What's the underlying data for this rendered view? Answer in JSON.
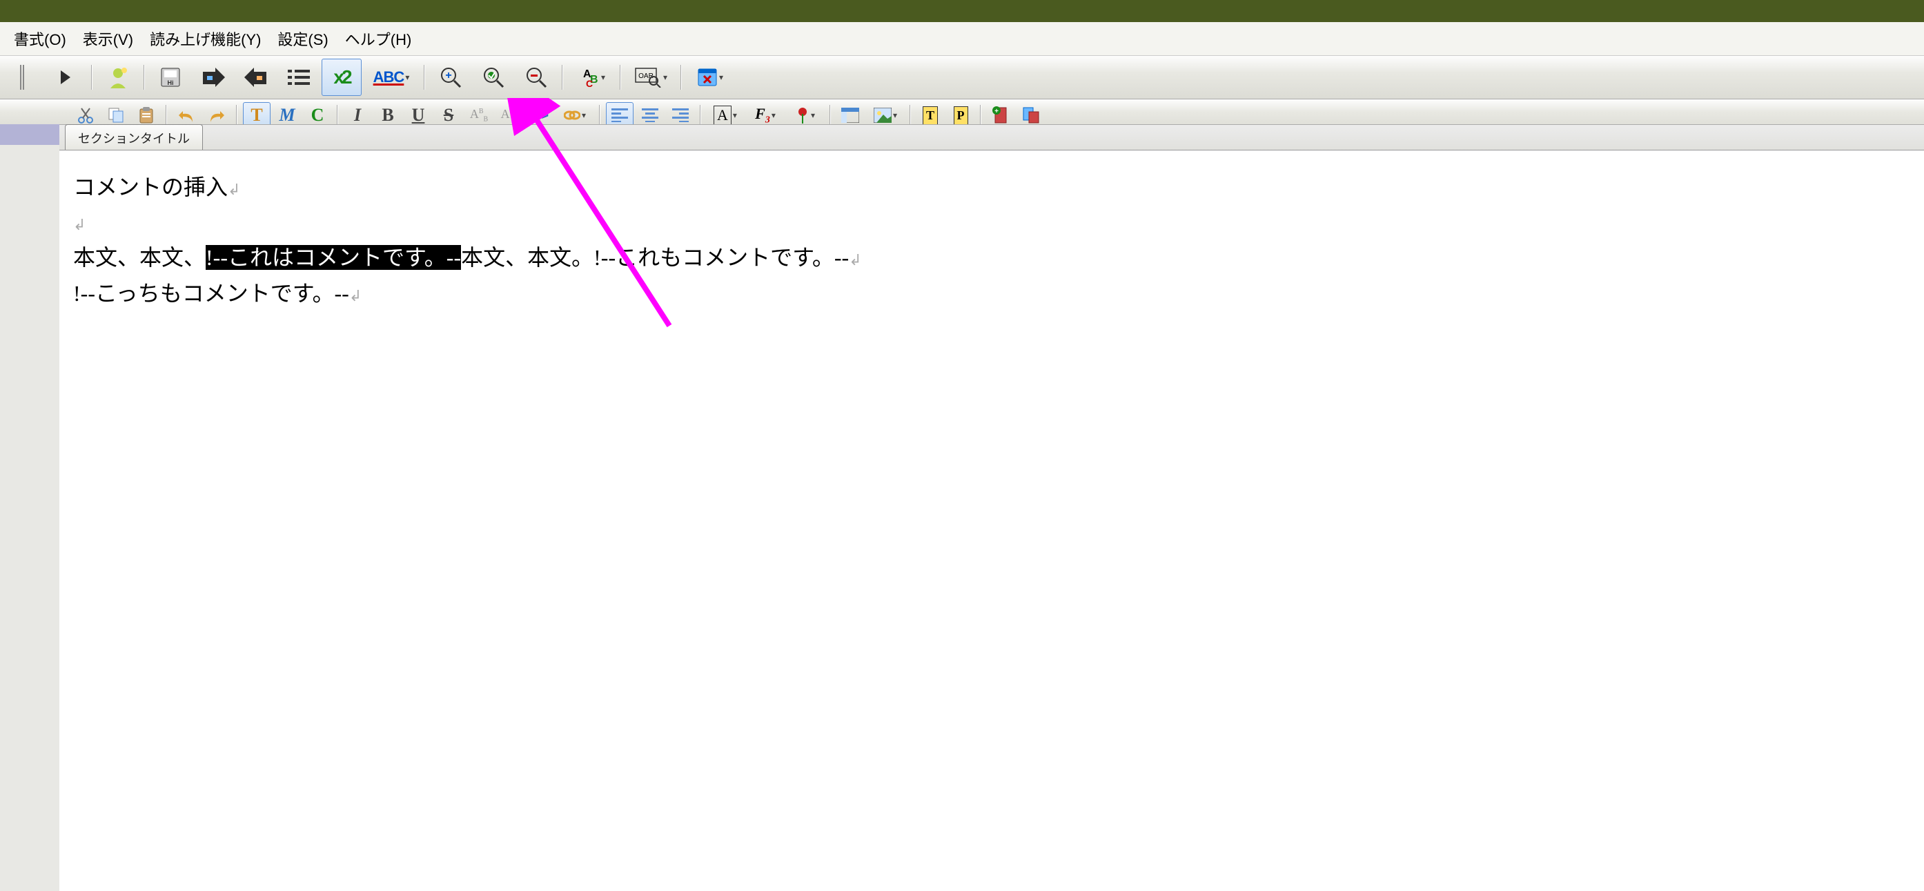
{
  "menu": {
    "format": "書式(O)",
    "view": "表示(V)",
    "read_aloud": "読み上げ機能(Y)",
    "settings": "設定(S)",
    "help": "ヘルプ(H)"
  },
  "toolbar1": {
    "x2_label": "x2",
    "abc_label": "ABC",
    "oar_label": "OAR"
  },
  "toolbar2": {
    "t": "T",
    "m": "M",
    "c": "C",
    "i": "I",
    "b": "B",
    "u": "U",
    "s": "S",
    "ab1": "AB",
    "ab2": "AB",
    "code": "</>",
    "a_font": "A",
    "f3": "F3",
    "t2": "T",
    "p2": "P"
  },
  "left_panel": {},
  "doc_tab": "セクションタイトル",
  "content": {
    "line1": "コメントの挿入",
    "line3_pre": "本文、本文、",
    "line3_sel": "!--これはコメントです。--",
    "line3_mid": "本文、本文。",
    "line3_post": "!--これもコメントです。--",
    "line4": "!--こっちもコメントです。--"
  },
  "colors": {
    "titlebar": "#4a5a1f",
    "arrow": "#ff00ff"
  }
}
